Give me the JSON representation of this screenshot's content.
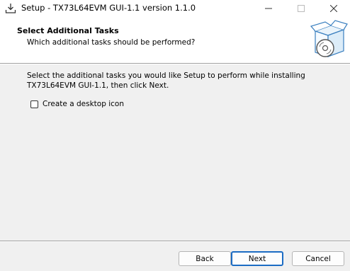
{
  "window": {
    "title": "Setup - TX73L64EVM GUI-1.1 version 1.1.0",
    "minimize_icon": "minimize-icon",
    "maximize_icon": "maximize-icon",
    "close_icon": "close-icon"
  },
  "header": {
    "title": "Select Additional Tasks",
    "subtitle": "Which additional tasks should be performed?",
    "graphic_icon": "setup-box-disc-icon"
  },
  "body": {
    "description": "Select the additional tasks you would like Setup to perform while installing TX73L64EVM GUI-1.1, then click Next.",
    "tasks": [
      {
        "label": "Create a desktop icon",
        "checked": false
      }
    ]
  },
  "buttons": {
    "back": "Back",
    "next": "Next",
    "cancel": "Cancel"
  },
  "colors": {
    "accent": "#1c6cc4",
    "window_bg": "#f0f0f0",
    "header_bg": "#ffffff"
  }
}
